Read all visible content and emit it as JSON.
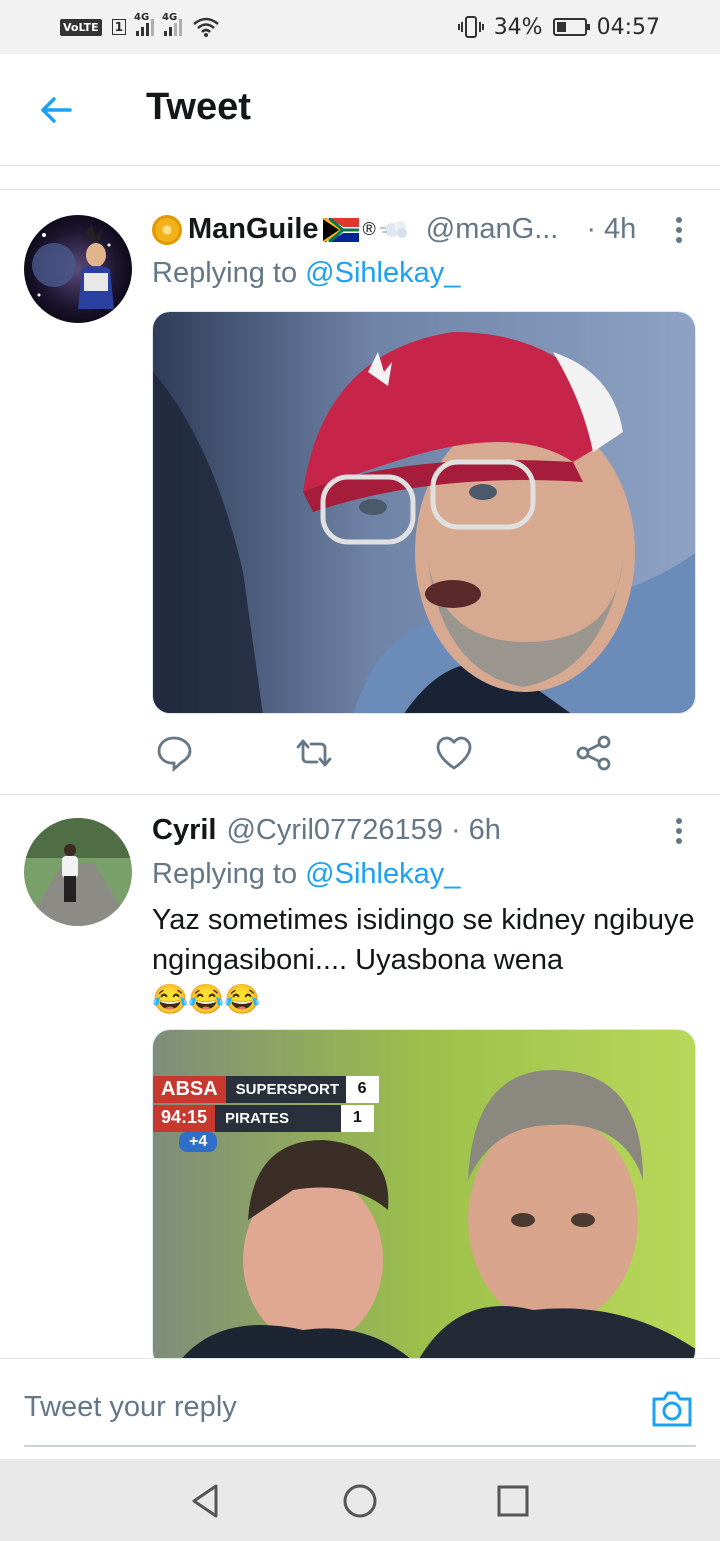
{
  "status_bar": {
    "left": {
      "volte": "VoLTE",
      "sim": "1",
      "net1": "4G",
      "net2": "4G"
    },
    "battery": "34%",
    "battery_level": 0.34,
    "time": "04:57"
  },
  "header": {
    "title": "Tweet"
  },
  "tweets": [
    {
      "name": "ManGuile",
      "handle": "@manG...",
      "separator": "·",
      "time": "4h",
      "replying_prefix": "Replying to ",
      "replying_to": "@Sihlekay_",
      "text": "",
      "media": "photo"
    },
    {
      "name": "Cyril",
      "handle": "@Cyril07726159",
      "separator": "·",
      "time": "6h",
      "replying_prefix": "Replying to ",
      "replying_to": "@Sihlekay_",
      "text": "Yaz sometimes isidingo se kidney ngibuye ngingasiboni.... Uyasbona wena",
      "emoji": "😂😂😂",
      "media": "photo",
      "scoreboard": {
        "sponsor": "ABSA",
        "clock": "94:15",
        "added": "+4",
        "team1": "SUPERSPORT",
        "score1": "6",
        "team2": "PIRATES",
        "score2": "1"
      }
    }
  ],
  "reply_bar": {
    "placeholder": "Tweet your reply"
  },
  "colors": {
    "accent": "#1da1f2",
    "secondary_text": "#657786",
    "border": "#e1e8ed"
  }
}
